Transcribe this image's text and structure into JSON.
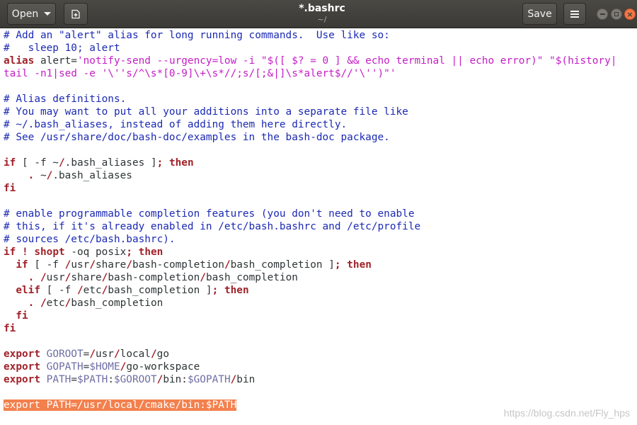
{
  "window": {
    "title": "*.bashrc",
    "subtitle": "~/",
    "open_label": "Open",
    "save_label": "Save",
    "close_glyph": "×"
  },
  "editor": {
    "lines": [
      [
        [
          "comment",
          "# Add an \"alert\" alias for long running commands.  Use like so:"
        ]
      ],
      [
        [
          "comment",
          "#   sleep 10; alert"
        ]
      ],
      [
        [
          "keyword",
          "alias"
        ],
        [
          "plain",
          " alert="
        ],
        [
          "string",
          "'notify-send --urgency=low -i \"$([ $? = 0 ] && echo terminal || echo error)\" \"$(history|"
        ]
      ],
      [
        [
          "string",
          "tail -n1|sed -e '\\''s/^\\s*[0-9]\\+\\s*//;s/[;&|]\\s*alert$//'\\'')\"'"
        ]
      ],
      [],
      [
        [
          "comment",
          "# Alias definitions."
        ]
      ],
      [
        [
          "comment",
          "# You may want to put all your additions into a separate file like"
        ]
      ],
      [
        [
          "comment",
          "# ~/.bash_aliases, instead of adding them here directly."
        ]
      ],
      [
        [
          "comment",
          "# See /usr/share/doc/bash-doc/examples in the bash-doc package."
        ]
      ],
      [],
      [
        [
          "keyword",
          "if"
        ],
        [
          "plain",
          " [ -f ~"
        ],
        [
          "punct",
          "/"
        ],
        [
          "plain",
          ".bash_aliases ]"
        ],
        [
          "punct",
          ";"
        ],
        [
          "plain",
          " "
        ],
        [
          "keyword",
          "then"
        ]
      ],
      [
        [
          "plain",
          "    "
        ],
        [
          "punct",
          "."
        ],
        [
          "plain",
          " ~"
        ],
        [
          "punct",
          "/"
        ],
        [
          "plain",
          ".bash_aliases"
        ]
      ],
      [
        [
          "keyword",
          "fi"
        ]
      ],
      [],
      [
        [
          "comment",
          "# enable programmable completion features (you don't need to enable"
        ]
      ],
      [
        [
          "comment",
          "# this, if it's already enabled in /etc/bash.bashrc and /etc/profile"
        ]
      ],
      [
        [
          "comment",
          "# sources /etc/bash.bashrc)."
        ]
      ],
      [
        [
          "keyword",
          "if"
        ],
        [
          "plain",
          " "
        ],
        [
          "punct",
          "!"
        ],
        [
          "plain",
          " "
        ],
        [
          "keyword",
          "shopt"
        ],
        [
          "plain",
          " -oq posix"
        ],
        [
          "punct",
          ";"
        ],
        [
          "plain",
          " "
        ],
        [
          "keyword",
          "then"
        ]
      ],
      [
        [
          "plain",
          "  "
        ],
        [
          "keyword",
          "if"
        ],
        [
          "plain",
          " [ -f "
        ],
        [
          "punct",
          "/"
        ],
        [
          "plain",
          "usr"
        ],
        [
          "punct",
          "/"
        ],
        [
          "plain",
          "share"
        ],
        [
          "punct",
          "/"
        ],
        [
          "plain",
          "bash-completion"
        ],
        [
          "punct",
          "/"
        ],
        [
          "plain",
          "bash_completion ]"
        ],
        [
          "punct",
          ";"
        ],
        [
          "plain",
          " "
        ],
        [
          "keyword",
          "then"
        ]
      ],
      [
        [
          "plain",
          "    "
        ],
        [
          "punct",
          "."
        ],
        [
          "plain",
          " "
        ],
        [
          "punct",
          "/"
        ],
        [
          "plain",
          "usr"
        ],
        [
          "punct",
          "/"
        ],
        [
          "plain",
          "share"
        ],
        [
          "punct",
          "/"
        ],
        [
          "plain",
          "bash-completion"
        ],
        [
          "punct",
          "/"
        ],
        [
          "plain",
          "bash_completion"
        ]
      ],
      [
        [
          "plain",
          "  "
        ],
        [
          "keyword",
          "elif"
        ],
        [
          "plain",
          " [ -f "
        ],
        [
          "punct",
          "/"
        ],
        [
          "plain",
          "etc"
        ],
        [
          "punct",
          "/"
        ],
        [
          "plain",
          "bash_completion ]"
        ],
        [
          "punct",
          ";"
        ],
        [
          "plain",
          " "
        ],
        [
          "keyword",
          "then"
        ]
      ],
      [
        [
          "plain",
          "    "
        ],
        [
          "punct",
          "."
        ],
        [
          "plain",
          " "
        ],
        [
          "punct",
          "/"
        ],
        [
          "plain",
          "etc"
        ],
        [
          "punct",
          "/"
        ],
        [
          "plain",
          "bash_completion"
        ]
      ],
      [
        [
          "plain",
          "  "
        ],
        [
          "keyword",
          "fi"
        ]
      ],
      [
        [
          "keyword",
          "fi"
        ]
      ],
      [],
      [
        [
          "keyword",
          "export"
        ],
        [
          "plain",
          " "
        ],
        [
          "var",
          "GOROOT"
        ],
        [
          "plain",
          "="
        ],
        [
          "punct",
          "/"
        ],
        [
          "plain",
          "usr"
        ],
        [
          "punct",
          "/"
        ],
        [
          "plain",
          "local"
        ],
        [
          "punct",
          "/"
        ],
        [
          "plain",
          "go"
        ]
      ],
      [
        [
          "keyword",
          "export"
        ],
        [
          "plain",
          " "
        ],
        [
          "var",
          "GOPATH"
        ],
        [
          "plain",
          "="
        ],
        [
          "var",
          "$HOME"
        ],
        [
          "punct",
          "/"
        ],
        [
          "plain",
          "go-workspace"
        ]
      ],
      [
        [
          "keyword",
          "export"
        ],
        [
          "plain",
          " "
        ],
        [
          "var",
          "PATH"
        ],
        [
          "plain",
          "="
        ],
        [
          "var",
          "$PATH"
        ],
        [
          "plain",
          ":"
        ],
        [
          "var",
          "$GOROOT"
        ],
        [
          "punct",
          "/"
        ],
        [
          "plain",
          "bin:"
        ],
        [
          "var",
          "$GOPATH"
        ],
        [
          "punct",
          "/"
        ],
        [
          "plain",
          "bin"
        ]
      ],
      [],
      [
        [
          "hl",
          "export PATH=/usr/local/cmake/bin:$PATH"
        ]
      ]
    ]
  },
  "watermark": "https://blog.csdn.net/Fly_hps"
}
